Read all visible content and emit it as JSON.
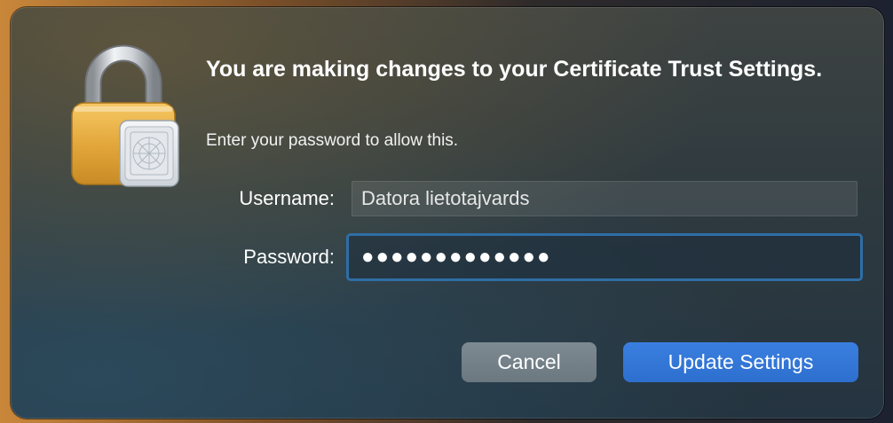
{
  "dialog": {
    "title": "You are making changes to your Certificate Trust Settings.",
    "subtitle": "Enter your password to allow this.",
    "icon": "lock-certificate-icon"
  },
  "form": {
    "username_label": "Username:",
    "username_value": "Datora lietotajvards",
    "password_label": "Password:",
    "password_masked": "●●●●●●●●●●●●●"
  },
  "buttons": {
    "cancel_label": "Cancel",
    "update_label": "Update Settings"
  },
  "colors": {
    "accent": "#2d6fce",
    "focus_ring": "#2f6ea6"
  }
}
